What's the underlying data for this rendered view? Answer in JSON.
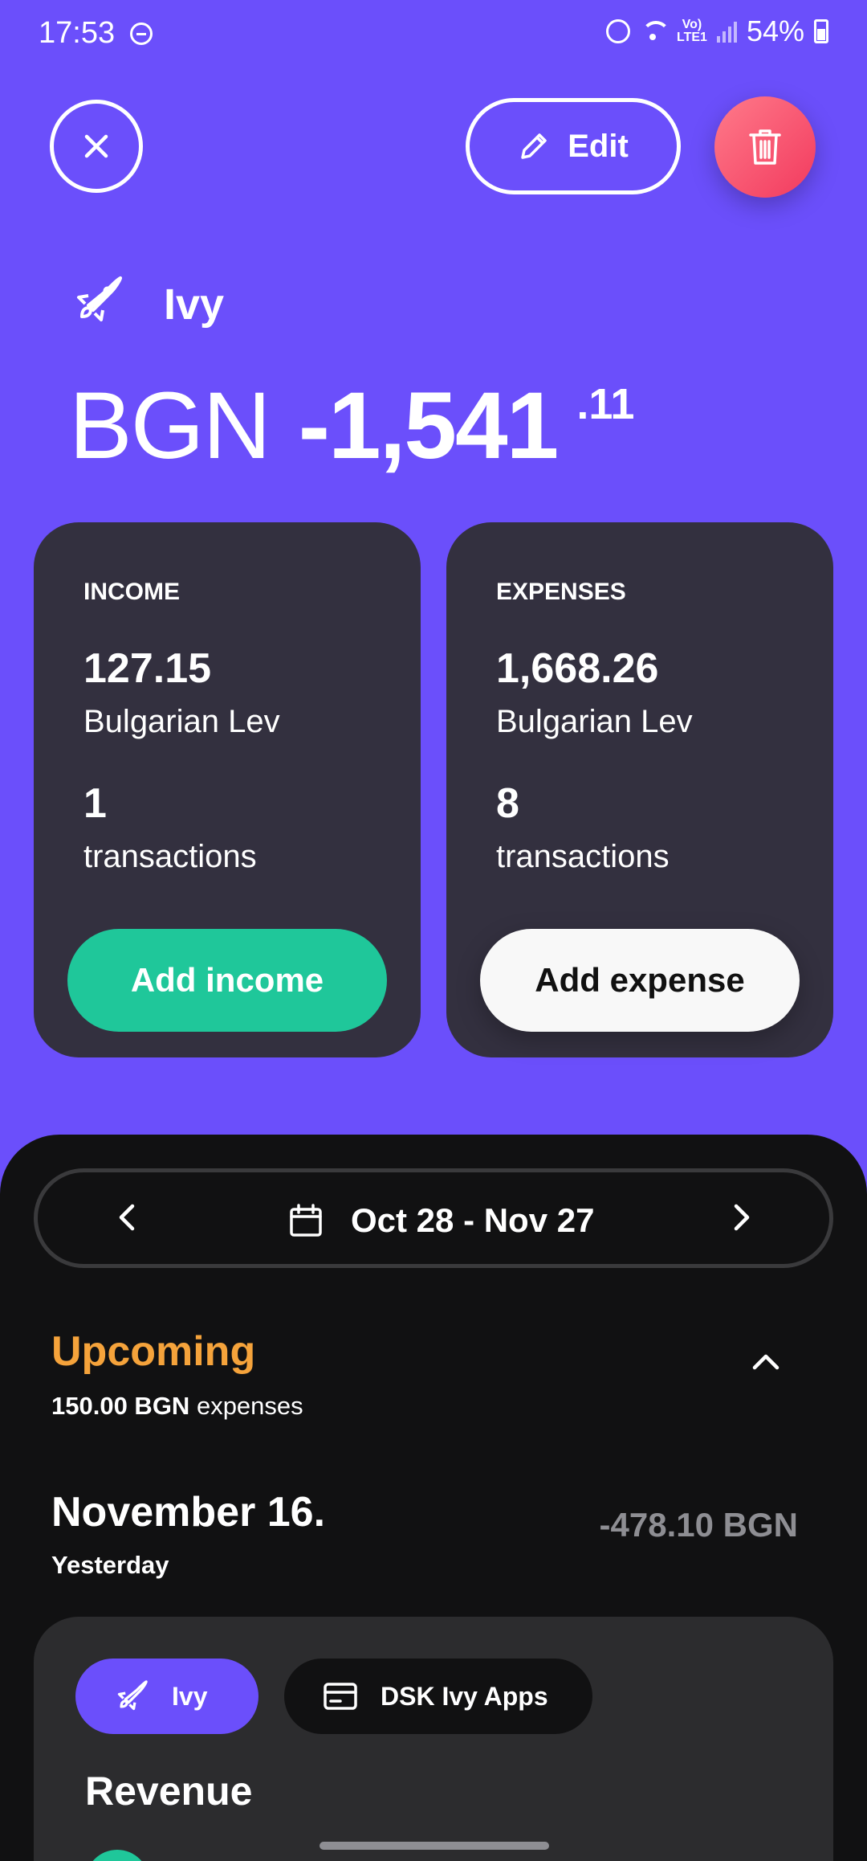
{
  "status_bar": {
    "time": "17:53",
    "battery": "54%"
  },
  "header": {
    "close_icon": "close-icon",
    "edit_label": "Edit",
    "delete_icon": "trash-icon"
  },
  "account": {
    "name": "Ivy",
    "icon": "rocket-icon",
    "balance_currency": "BGN",
    "balance_integer": "-1,541",
    "balance_decimal": ".11"
  },
  "income": {
    "label": "INCOME",
    "amount": "127.15",
    "currency": "Bulgarian Lev",
    "count": "1",
    "count_label": "transactions",
    "button": "Add income"
  },
  "expenses": {
    "label": "EXPENSES",
    "amount": "1,668.26",
    "currency": "Bulgarian Lev",
    "count": "8",
    "count_label": "transactions",
    "button": "Add expense"
  },
  "date_range": {
    "label": "Oct 28 - Nov 27"
  },
  "upcoming": {
    "title": "Upcoming",
    "amount": "150.00 BGN",
    "suffix": "expenses"
  },
  "day": {
    "title": "November 16.",
    "subtitle": "Yesterday",
    "total": "-478.10 BGN"
  },
  "transaction": {
    "account_chip": "Ivy",
    "category_chip": "DSK Ivy Apps",
    "title": "Revenue"
  },
  "colors": {
    "primary": "#6b4ffb",
    "income": "#1fc79a",
    "delete": "#f23a5e",
    "upcoming": "#f5a33b"
  }
}
